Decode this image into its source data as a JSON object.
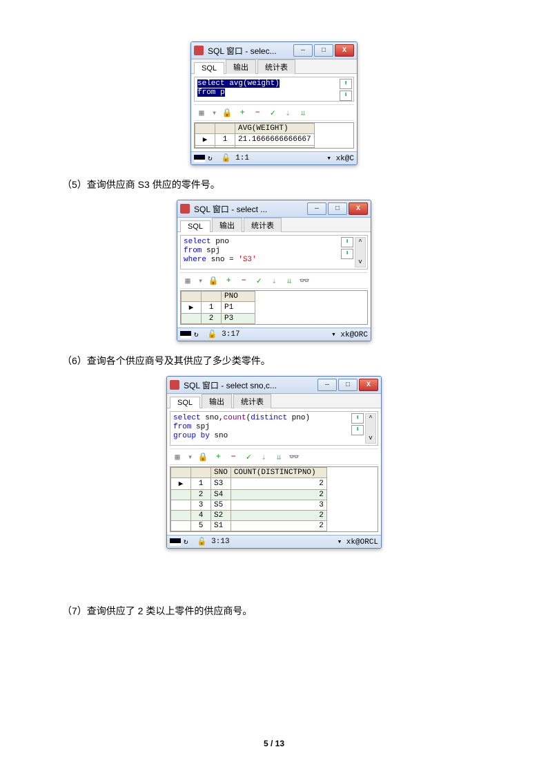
{
  "captions": {
    "q5": "（5）查询供应商 S3 供应的零件号。",
    "q6": "（6）查询各个供应商号及其供应了多少类零件。",
    "q7": "（7）查询供应了 2 类以上零件的供应商号。"
  },
  "win1": {
    "title": "SQL 窗口 - selec...",
    "tabs": [
      "SQL",
      "输出",
      "统计表"
    ],
    "sql_line1": "select avg(weight)",
    "sql_line2": "from p",
    "header": "AVG(WEIGHT)",
    "row1_idx": "1",
    "row1_val": "21.1666666666667",
    "status_pos": "1:1",
    "status_right": "▾ xk@C"
  },
  "win2": {
    "title": "SQL 窗口 - select ...",
    "tabs": [
      "SQL",
      "输出",
      "统计表"
    ],
    "sql_l1_kw": "select",
    "sql_l1_rest": " pno",
    "sql_l2_kw": "from",
    "sql_l2_rest": " spj",
    "sql_l3_kw": "where",
    "sql_l3_rest1": " sno = ",
    "sql_l3_str": "'S3'",
    "header": "PNO",
    "rows": [
      [
        "1",
        "P1"
      ],
      [
        "2",
        "P3"
      ]
    ],
    "status_pos": "3:17",
    "status_right": "▾ xk@ORC"
  },
  "win3": {
    "title": "SQL 窗口 - select sno,c...",
    "tabs": [
      "SQL",
      "输出",
      "统计表"
    ],
    "sql_l1a": "select",
    "sql_l1b": " sno,",
    "sql_l1c": "count",
    "sql_l1d": "(",
    "sql_l1e": "distinct",
    "sql_l1f": " pno)",
    "sql_l2a": "from",
    "sql_l2b": " spj",
    "sql_l3a": "group by",
    "sql_l3b": " sno",
    "h1": "SNO",
    "h2": "COUNT(DISTINCTPNO)",
    "rows": [
      [
        "1",
        "S3",
        "2"
      ],
      [
        "2",
        "S4",
        "2"
      ],
      [
        "3",
        "S5",
        "3"
      ],
      [
        "4",
        "S2",
        "2"
      ],
      [
        "5",
        "S1",
        "2"
      ]
    ],
    "status_pos": "3:13",
    "status_right": "▾ xk@ORCL"
  },
  "footer": "5 / 13",
  "icons": {
    "min": "—",
    "max": "□",
    "close": "X",
    "up": "⬆",
    "down": "⬇",
    "refresh": "↻",
    "lock": "🔒",
    "plus": "+",
    "minus": "−",
    "check": "✓",
    "dcheck": "✓✓",
    "play": "▸",
    "binoc": "👓"
  }
}
